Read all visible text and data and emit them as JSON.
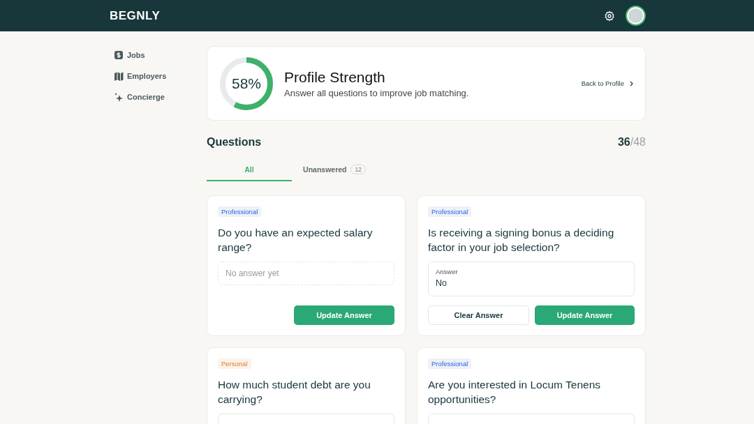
{
  "header": {
    "logo": "BEGNLY"
  },
  "sidebar": {
    "items": [
      {
        "label": "Jobs",
        "kind": "dollar"
      },
      {
        "label": "Employers",
        "kind": "map"
      },
      {
        "label": "Concierge",
        "kind": "sparkle"
      }
    ]
  },
  "profile_strength": {
    "level": 0.58,
    "percent": "58%",
    "title": "Profile Strength",
    "subtitle": "Answer all questions to improve job matching.",
    "link": "Back to Profile"
  },
  "questions": {
    "title": "Questions",
    "answered": "36",
    "total": "/48",
    "tabs": [
      {
        "label": "All",
        "selected": true
      },
      {
        "label": "Unanswered",
        "count": "12",
        "selected": false
      }
    ],
    "cards": [
      {
        "tag": "Professional",
        "kind": "professional",
        "question": "Do you have an expected salary range?",
        "field": {
          "kind": "empty",
          "placeholder": "No answer yet"
        },
        "buttons": [
          {
            "label": "Update Answer",
            "kind": "primary"
          }
        ]
      },
      {
        "tag": "Professional",
        "kind": "professional",
        "question": "Is receiving a signing bonus a deciding factor in your job selection?",
        "field": {
          "kind": "answered",
          "label": "Answer",
          "value": "No"
        },
        "buttons": [
          {
            "label": "Clear Answer",
            "kind": "secondary"
          },
          {
            "label": "Update Answer",
            "kind": "primary"
          }
        ]
      },
      {
        "tag": "Personal",
        "kind": "personal",
        "question": "How much student debt are you carrying?",
        "field": {
          "kind": "blank"
        }
      },
      {
        "tag": "Professional",
        "kind": "professional",
        "question": "Are you interested in Locum Tenens opportunities?",
        "field": {
          "kind": "blank"
        }
      }
    ]
  }
}
